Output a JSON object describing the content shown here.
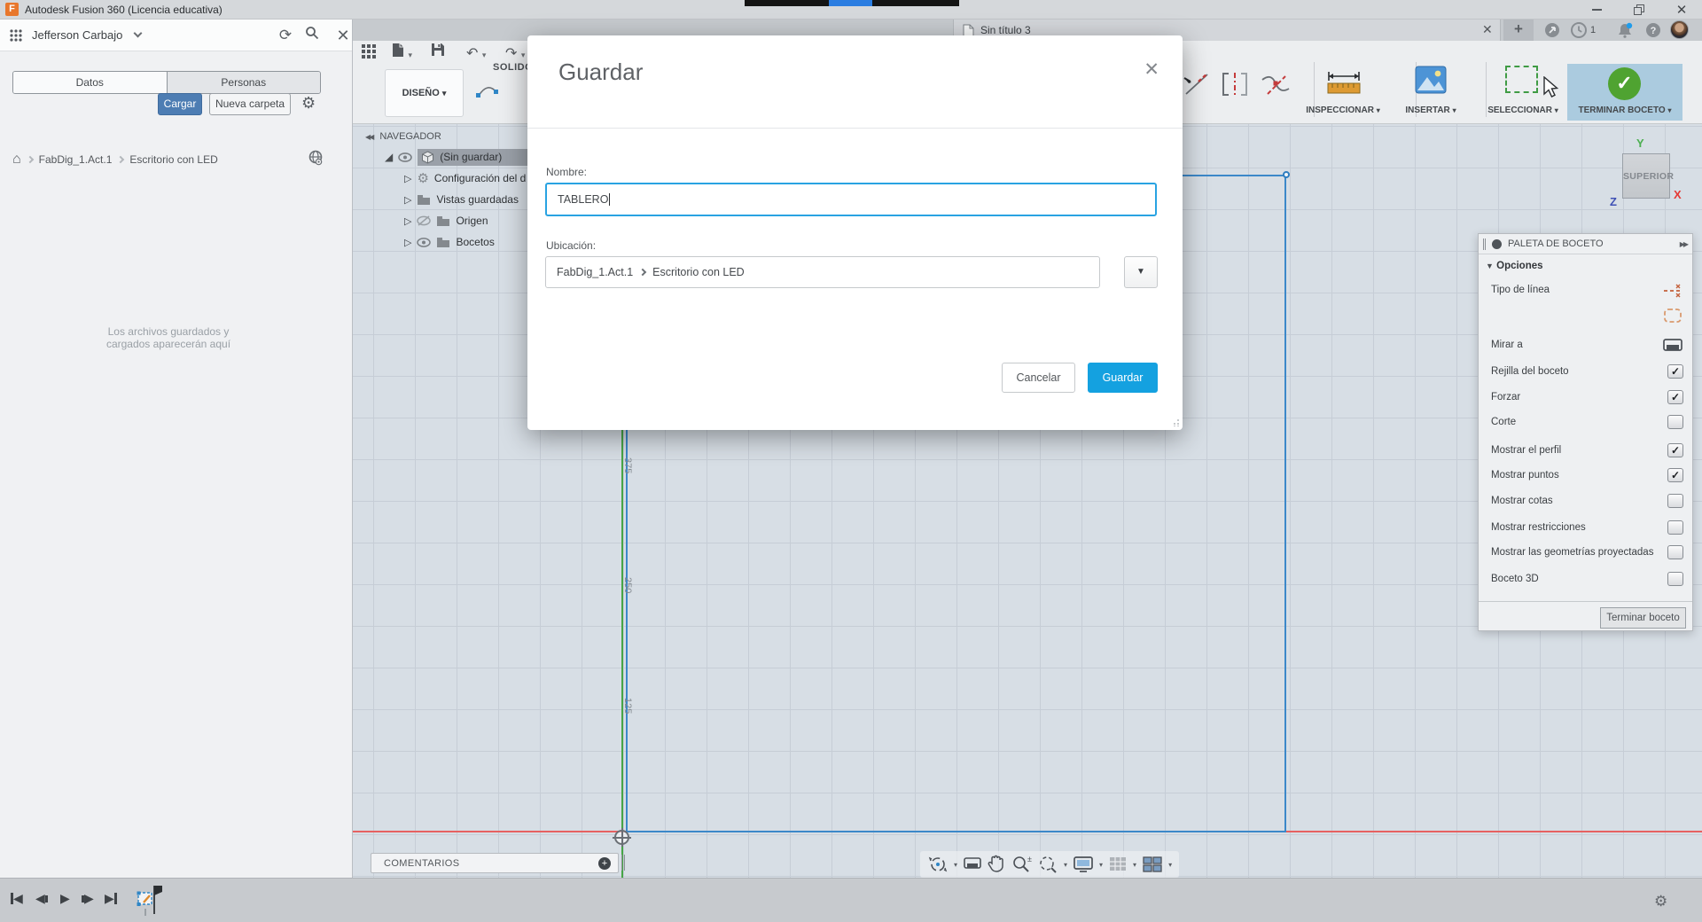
{
  "title_bar": {
    "app_title": "Autodesk Fusion 360 (Licencia educativa)",
    "logo_letter": "F"
  },
  "left_panel": {
    "user_name": "Jefferson Carbajo",
    "tabs": {
      "datos": "Datos",
      "personas": "Personas"
    },
    "upload_button": "Cargar",
    "new_folder_button": "Nueva carpeta",
    "breadcrumb": {
      "project": "FabDig_1.Act.1",
      "item": "Escritorio con LED"
    },
    "empty_hint_line1": "Los archivos guardados y",
    "empty_hint_line2": "cargados aparecerán aquí"
  },
  "tab_strip": {
    "document_tab": "Sin título 3",
    "add_tab": "+",
    "job_count": "1"
  },
  "toolbar": {
    "ribbon_tab": "SOLIDO",
    "design_dropdown": "DISEÑO",
    "groups": [
      {
        "label": "INSPECCIONAR"
      },
      {
        "label": "INSERTAR"
      },
      {
        "label": "SELECCIONAR"
      },
      {
        "label": "TERMINAR BOCETO"
      }
    ]
  },
  "navigator": {
    "header": "NAVEGADOR",
    "items": [
      {
        "label": "(Sin guardar)",
        "selected": true
      },
      {
        "label": "Configuración del d",
        "selected": false
      },
      {
        "label": "Vistas guardadas",
        "selected": false
      },
      {
        "label": "Origen",
        "selected": false,
        "hidden": true
      },
      {
        "label": "Bocetos",
        "selected": false
      }
    ]
  },
  "canvas": {
    "view_cube_face": "SUPERIOR",
    "axis_labels": {
      "x": "X",
      "y": "Y",
      "z": "Z"
    },
    "ruler_labels": [
      "375",
      "250",
      "125"
    ],
    "comments_label": "COMENTARIOS",
    "colors": {
      "axis_x": "#e66161",
      "axis_y": "#46a546",
      "sketch_line": "#3c88c9"
    }
  },
  "dialog": {
    "title": "Guardar",
    "name_label": "Nombre:",
    "name_value": "TABLERO",
    "location_label": "Ubicación:",
    "location_project": "FabDig_1.Act.1",
    "location_item": "Escritorio con LED",
    "cancel_button": "Cancelar",
    "save_button": "Guardar",
    "accent_color": "#14a1e0"
  },
  "sketch_palette": {
    "header": "PALETA DE BOCETO",
    "section": "Opciones",
    "options": [
      {
        "label": "Tipo de línea",
        "control": "construction-line-icon"
      },
      {
        "label": "",
        "control": "construction-rect-icon"
      },
      {
        "label": "Mirar a",
        "control": "look-at-icon"
      },
      {
        "label": "Rejilla del boceto",
        "checked": true
      },
      {
        "label": "Forzar",
        "checked": true
      },
      {
        "label": "Corte",
        "checked": false
      },
      {
        "label": "Mostrar el perfil",
        "checked": true
      },
      {
        "label": "Mostrar puntos",
        "checked": true
      },
      {
        "label": "Mostrar cotas",
        "checked": false
      },
      {
        "label": "Mostrar restricciones",
        "checked": false
      },
      {
        "label": "Mostrar las geometrías proyectadas",
        "checked": false
      },
      {
        "label": "Boceto 3D",
        "checked": false
      }
    ],
    "finish_button": "Terminar boceto"
  }
}
